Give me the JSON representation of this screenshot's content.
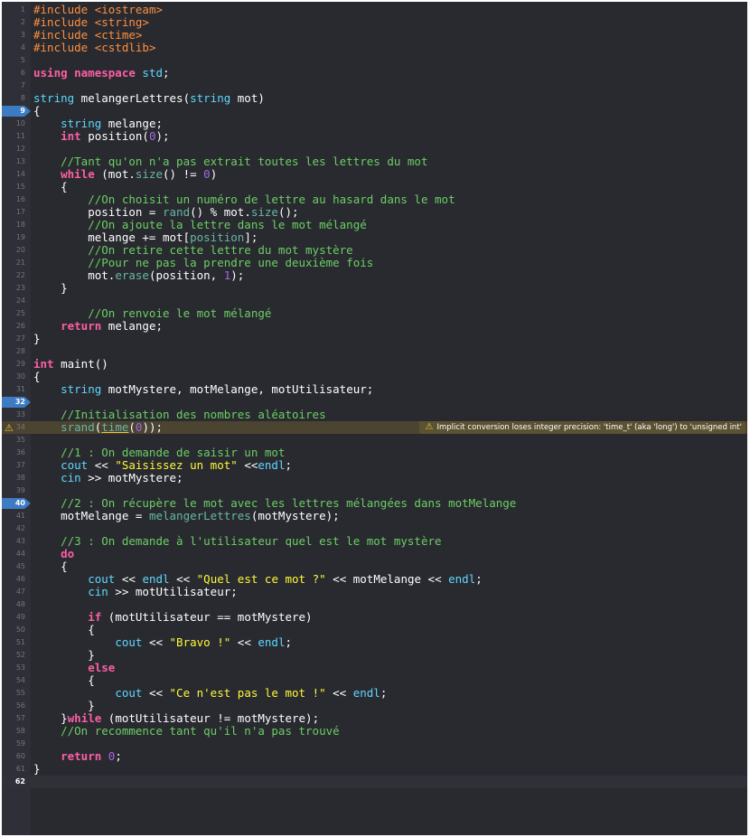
{
  "editor": {
    "lines": [
      {
        "n": "1",
        "tokens": [
          [
            "#include ",
            "pp"
          ],
          [
            "<iostream>",
            "pp"
          ]
        ]
      },
      {
        "n": "2",
        "tokens": [
          [
            "#include ",
            "pp"
          ],
          [
            "<string>",
            "pp"
          ]
        ]
      },
      {
        "n": "3",
        "tokens": [
          [
            "#include ",
            "pp"
          ],
          [
            "<ctime>",
            "pp"
          ]
        ]
      },
      {
        "n": "4",
        "tokens": [
          [
            "#include ",
            "pp"
          ],
          [
            "<cstdlib>",
            "pp"
          ]
        ]
      },
      {
        "n": "5",
        "tokens": []
      },
      {
        "n": "6",
        "tokens": [
          [
            "using namespace ",
            "kw"
          ],
          [
            "std",
            "ty"
          ],
          [
            ";",
            "pl"
          ]
        ]
      },
      {
        "n": "7",
        "tokens": []
      },
      {
        "n": "8",
        "tokens": [
          [
            "string",
            "ty"
          ],
          [
            " melangerLettres(",
            "pl"
          ],
          [
            "string",
            "ty"
          ],
          [
            " mot)",
            "pl"
          ]
        ]
      },
      {
        "n": "9",
        "breakpoint": true,
        "tokens": [
          [
            "{",
            "pl"
          ]
        ]
      },
      {
        "n": "10",
        "tokens": [
          [
            "    ",
            "pl"
          ],
          [
            "string",
            "ty"
          ],
          [
            " melange;",
            "pl"
          ]
        ]
      },
      {
        "n": "11",
        "tokens": [
          [
            "    ",
            "pl"
          ],
          [
            "int",
            "kw"
          ],
          [
            " position(",
            "pl"
          ],
          [
            "0",
            "num2"
          ],
          [
            ");",
            "pl"
          ]
        ]
      },
      {
        "n": "12",
        "tokens": []
      },
      {
        "n": "13",
        "tokens": [
          [
            "    //Tant qu'on n'a pas extrait toutes les lettres du mot",
            "cm"
          ]
        ]
      },
      {
        "n": "14",
        "tokens": [
          [
            "    ",
            "pl"
          ],
          [
            "while",
            "kw"
          ],
          [
            " (mot.",
            "pl"
          ],
          [
            "size",
            "fn"
          ],
          [
            "() != ",
            "pl"
          ],
          [
            "0",
            "num2"
          ],
          [
            ")",
            "pl"
          ]
        ]
      },
      {
        "n": "15",
        "tokens": [
          [
            "    {",
            "pl"
          ]
        ]
      },
      {
        "n": "16",
        "tokens": [
          [
            "        //On choisit un numéro de lettre au hasard dans le mot",
            "cm"
          ]
        ]
      },
      {
        "n": "17",
        "tokens": [
          [
            "        position = ",
            "pl"
          ],
          [
            "rand",
            "fn"
          ],
          [
            "() % mot.",
            "pl"
          ],
          [
            "size",
            "fn"
          ],
          [
            "();",
            "pl"
          ]
        ]
      },
      {
        "n": "18",
        "tokens": [
          [
            "        //On ajoute la lettre dans le mot mélangé",
            "cm"
          ]
        ]
      },
      {
        "n": "19",
        "tokens": [
          [
            "        melange += mot[",
            "pl"
          ],
          [
            "position",
            "fn"
          ],
          [
            "];",
            "pl"
          ]
        ]
      },
      {
        "n": "20",
        "tokens": [
          [
            "        //On retire cette lettre du mot mystère",
            "cm"
          ]
        ]
      },
      {
        "n": "21",
        "tokens": [
          [
            "        //Pour ne pas la prendre une deuxième fois",
            "cm"
          ]
        ]
      },
      {
        "n": "22",
        "tokens": [
          [
            "        mot.",
            "pl"
          ],
          [
            "erase",
            "fn"
          ],
          [
            "(position, ",
            "pl"
          ],
          [
            "1",
            "num2"
          ],
          [
            ");",
            "pl"
          ]
        ]
      },
      {
        "n": "23",
        "tokens": [
          [
            "    }",
            "pl"
          ]
        ]
      },
      {
        "n": "24",
        "tokens": []
      },
      {
        "n": "25",
        "tokens": [
          [
            "        //On renvoie le mot mélangé",
            "cm"
          ]
        ]
      },
      {
        "n": "26",
        "tokens": [
          [
            "    ",
            "pl"
          ],
          [
            "return",
            "kw"
          ],
          [
            " melange;",
            "pl"
          ]
        ]
      },
      {
        "n": "27",
        "tokens": [
          [
            "}",
            "pl"
          ]
        ]
      },
      {
        "n": "28",
        "tokens": []
      },
      {
        "n": "29",
        "tokens": [
          [
            "int",
            "kw"
          ],
          [
            " maint()",
            "pl"
          ]
        ]
      },
      {
        "n": "30",
        "tokens": [
          [
            "{",
            "pl"
          ]
        ]
      },
      {
        "n": "31",
        "tokens": [
          [
            "    ",
            "pl"
          ],
          [
            "string",
            "ty"
          ],
          [
            " motMystere, motMelange, motUtilisateur;",
            "pl"
          ]
        ]
      },
      {
        "n": "32",
        "breakpoint": true,
        "tokens": []
      },
      {
        "n": "33",
        "tokens": [
          [
            "    //Initialisation des nombres aléatoires",
            "cm"
          ]
        ]
      },
      {
        "n": "34",
        "warning": true,
        "tokens": [
          [
            "    ",
            "pl"
          ],
          [
            "srand",
            "fn"
          ],
          [
            "(",
            "pl"
          ],
          [
            "time",
            "warnfn"
          ],
          [
            "(",
            "pl"
          ],
          [
            "0",
            "num2"
          ],
          [
            "));",
            "pl"
          ]
        ]
      },
      {
        "n": "35",
        "tokens": []
      },
      {
        "n": "36",
        "tokens": [
          [
            "    //1 : On demande de saisir un mot",
            "cm"
          ]
        ]
      },
      {
        "n": "37",
        "tokens": [
          [
            "    ",
            "pl"
          ],
          [
            "cout",
            "ty"
          ],
          [
            " << ",
            "pl"
          ],
          [
            "\"Saisissez un mot\"",
            "str"
          ],
          [
            " <<",
            "pl"
          ],
          [
            "endl",
            "ty"
          ],
          [
            ";",
            "pl"
          ]
        ]
      },
      {
        "n": "38",
        "tokens": [
          [
            "    ",
            "pl"
          ],
          [
            "cin",
            "ty"
          ],
          [
            " >> motMystere;",
            "pl"
          ]
        ]
      },
      {
        "n": "39",
        "tokens": []
      },
      {
        "n": "40",
        "breakpoint": true,
        "tokens": [
          [
            "    //2 : On récupère le mot avec les lettres mélangées dans motMelange",
            "cm"
          ]
        ]
      },
      {
        "n": "41",
        "tokens": [
          [
            "    motMelange = ",
            "pl"
          ],
          [
            "melangerLettres",
            "fn"
          ],
          [
            "(motMystere);",
            "pl"
          ]
        ]
      },
      {
        "n": "42",
        "tokens": []
      },
      {
        "n": "43",
        "tokens": [
          [
            "    //3 : On demande à l'utilisateur quel est le mot mystère",
            "cm"
          ]
        ]
      },
      {
        "n": "44",
        "tokens": [
          [
            "    ",
            "pl"
          ],
          [
            "do",
            "kw"
          ]
        ]
      },
      {
        "n": "45",
        "tokens": [
          [
            "    {",
            "pl"
          ]
        ]
      },
      {
        "n": "46",
        "tokens": [
          [
            "        ",
            "pl"
          ],
          [
            "cout",
            "ty"
          ],
          [
            " << ",
            "pl"
          ],
          [
            "endl",
            "ty"
          ],
          [
            " << ",
            "pl"
          ],
          [
            "\"Quel est ce mot ?\"",
            "str"
          ],
          [
            " << motMelange << ",
            "pl"
          ],
          [
            "endl",
            "ty"
          ],
          [
            ";",
            "pl"
          ]
        ]
      },
      {
        "n": "47",
        "tokens": [
          [
            "        ",
            "pl"
          ],
          [
            "cin",
            "ty"
          ],
          [
            " >> motUtilisateur;",
            "pl"
          ]
        ]
      },
      {
        "n": "48",
        "tokens": []
      },
      {
        "n": "49",
        "tokens": [
          [
            "        ",
            "pl"
          ],
          [
            "if",
            "kw"
          ],
          [
            " (motUtilisateur == motMystere)",
            "pl"
          ]
        ]
      },
      {
        "n": "50",
        "tokens": [
          [
            "        {",
            "pl"
          ]
        ]
      },
      {
        "n": "51",
        "tokens": [
          [
            "            ",
            "pl"
          ],
          [
            "cout",
            "ty"
          ],
          [
            " << ",
            "pl"
          ],
          [
            "\"Bravo !\"",
            "str"
          ],
          [
            " << ",
            "pl"
          ],
          [
            "endl",
            "ty"
          ],
          [
            ";",
            "pl"
          ]
        ]
      },
      {
        "n": "52",
        "tokens": [
          [
            "        }",
            "pl"
          ]
        ]
      },
      {
        "n": "53",
        "tokens": [
          [
            "        ",
            "pl"
          ],
          [
            "else",
            "kw"
          ]
        ]
      },
      {
        "n": "54",
        "tokens": [
          [
            "        {",
            "pl"
          ]
        ]
      },
      {
        "n": "55",
        "tokens": [
          [
            "            ",
            "pl"
          ],
          [
            "cout",
            "ty"
          ],
          [
            " << ",
            "pl"
          ],
          [
            "\"Ce n'est pas le mot !\"",
            "str"
          ],
          [
            " << ",
            "pl"
          ],
          [
            "endl",
            "ty"
          ],
          [
            ";",
            "pl"
          ]
        ]
      },
      {
        "n": "56",
        "tokens": [
          [
            "        }",
            "pl"
          ]
        ]
      },
      {
        "n": "57",
        "tokens": [
          [
            "    }",
            "pl"
          ],
          [
            "while",
            "kw"
          ],
          [
            " (motUtilisateur != motMystere);",
            "pl"
          ]
        ]
      },
      {
        "n": "58",
        "tokens": [
          [
            "    //On recommence tant qu'il n'a pas trouvé",
            "cm"
          ]
        ]
      },
      {
        "n": "59",
        "tokens": []
      },
      {
        "n": "60",
        "tokens": [
          [
            "    ",
            "pl"
          ],
          [
            "return",
            "kw"
          ],
          [
            " ",
            "pl"
          ],
          [
            "0",
            "num2"
          ],
          [
            ";",
            "pl"
          ]
        ]
      },
      {
        "n": "61",
        "tokens": [
          [
            "}",
            "pl"
          ]
        ]
      },
      {
        "n": "62",
        "current": true,
        "tokens": []
      }
    ]
  },
  "warning": {
    "icon": "warning-triangle-icon",
    "message": "Implicit conversion loses integer precision: 'time_t' (aka 'long') to 'unsigned int'"
  }
}
